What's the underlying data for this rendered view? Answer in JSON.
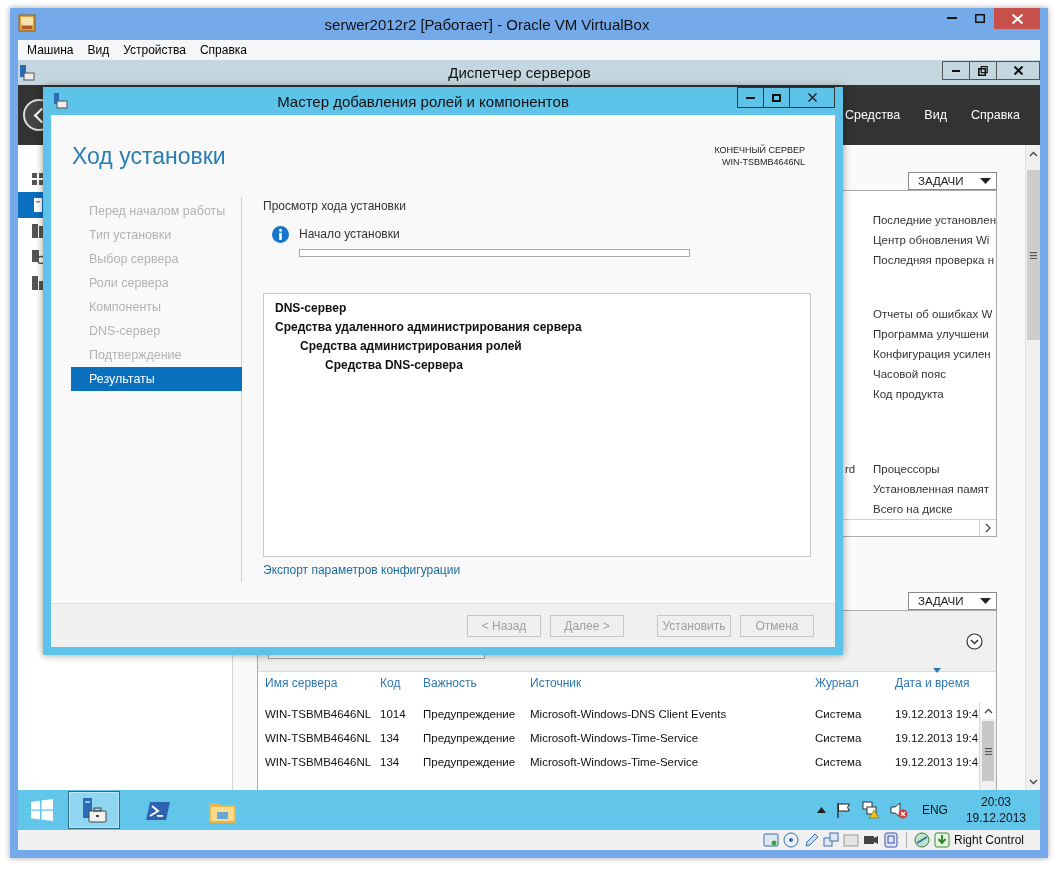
{
  "window": {
    "title": "serwer2012r2 [Работает] - Oracle VM VirtualBox"
  },
  "menu": [
    {
      "label": "Машина"
    },
    {
      "label": "Вид"
    },
    {
      "label": "Устройства"
    },
    {
      "label": "Справка"
    }
  ],
  "server_manager": {
    "title": "Диспетчер серверов",
    "header_menu": [
      {
        "label": "Средства"
      },
      {
        "label": "Вид"
      },
      {
        "label": "Справка"
      }
    ],
    "sidebar": {
      "items": [
        {
          "kind": "dashboard",
          "selected": false
        },
        {
          "kind": "local-server",
          "selected": true
        },
        {
          "kind": "all-servers",
          "selected": false
        },
        {
          "kind": "dns",
          "selected": false
        },
        {
          "kind": "file-services",
          "selected": false
        }
      ]
    },
    "properties": {
      "tasks_button": "ЗАДАЧИ",
      "groups": [
        {
          "rows": [
            {
              "label": "Последние установлен"
            },
            {
              "label": "Центр обновления Wi"
            },
            {
              "label": "Последняя проверка н"
            }
          ]
        },
        {
          "rows": [
            {
              "label": "Отчеты об ошибках W"
            },
            {
              "label": "Программа улучшени"
            },
            {
              "label": "Конфигурация усилен"
            },
            {
              "label": "Часовой пояс"
            },
            {
              "label": "Код продукта"
            }
          ]
        },
        {
          "rows": [
            {
              "value": "rd",
              "label": "Процессоры"
            },
            {
              "label": "Установленная памят"
            },
            {
              "label": "Всего на диске"
            }
          ]
        }
      ]
    },
    "events": {
      "tasks_button": "ЗАДАЧИ",
      "columns": [
        {
          "label": "Имя сервера",
          "sorted": false
        },
        {
          "label": "Код",
          "sorted": false
        },
        {
          "label": "Важность",
          "sorted": false
        },
        {
          "label": "Источник",
          "sorted": false
        },
        {
          "label": "Журнал",
          "sorted": false
        },
        {
          "label": "Дата и время",
          "sorted": true
        }
      ],
      "rows": [
        [
          "WIN-TSBMB4646NL",
          "1014",
          "Предупреждение",
          "Microsoft-Windows-DNS Client Events",
          "Система",
          "19.12.2013 19:4"
        ],
        [
          "WIN-TSBMB4646NL",
          "134",
          "Предупреждение",
          "Microsoft-Windows-Time-Service",
          "Система",
          "19.12.2013 19:4"
        ],
        [
          "WIN-TSBMB4646NL",
          "134",
          "Предупреждение",
          "Microsoft-Windows-Time-Service",
          "Система",
          "19.12.2013 19:4"
        ]
      ]
    }
  },
  "wizard": {
    "title": "Мастер добавления ролей и компонентов",
    "heading": "Ход установки",
    "target_label": "КОНЕЧНЫЙ СЕРВЕР",
    "target_server": "WIN-TSBMB4646NL",
    "steps": [
      {
        "label": "Перед началом работы",
        "selected": false
      },
      {
        "label": "Тип установки",
        "selected": false
      },
      {
        "label": "Выбор сервера",
        "selected": false
      },
      {
        "label": "Роли сервера",
        "selected": false
      },
      {
        "label": "Компоненты",
        "selected": false
      },
      {
        "label": "DNS-сервер",
        "selected": false
      },
      {
        "label": "Подтверждение",
        "selected": false
      },
      {
        "label": "Результаты",
        "selected": true
      }
    ],
    "section_title": "Просмотр хода установки",
    "status": "Начало установки",
    "progress": {
      "level": 0
    },
    "features": [
      {
        "label": "DNS-сервер"
      },
      {
        "label": "Средства удаленного администрирования сервера",
        "children": [
          {
            "label": "Средства администрирования ролей",
            "children": [
              {
                "label": "Средства DNS-сервера"
              }
            ]
          }
        ]
      }
    ],
    "export_link": "Экспорт параметров конфигурации",
    "buttons": [
      {
        "label": "< Назад",
        "disabled": true
      },
      {
        "label": "Далее >",
        "disabled": true
      },
      {
        "label": "Установить",
        "disabled": true
      },
      {
        "label": "Отмена",
        "disabled": true
      }
    ]
  },
  "taskbar": {
    "apps": [
      {
        "kind": "server-manager",
        "selected": true
      },
      {
        "kind": "powershell",
        "selected": false
      },
      {
        "kind": "explorer",
        "selected": false
      }
    ],
    "language": "ENG",
    "time": "20:03",
    "date": "19.12.2013"
  },
  "status_bar": {
    "host_key": "Right Control"
  }
}
